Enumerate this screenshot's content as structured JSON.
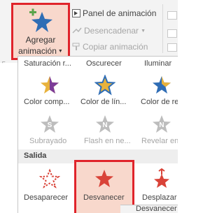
{
  "ribbon": {
    "add_animation_line1": "Agregar",
    "add_animation_line2": "animación",
    "animation_pane": "Panel de animación",
    "trigger": "Desencadenar",
    "animation_painter": "Copiar animación"
  },
  "gallery": {
    "row1": [
      "Saturación r...",
      "Oscurecer",
      "Iluminar"
    ],
    "row2": [
      "Color comp...",
      "Color de lín...",
      "Color de re"
    ],
    "row3": [
      "Subrayado",
      "Flash en ne...",
      "Revelar en"
    ],
    "section_exit": "Salida",
    "row4": [
      "Desaparecer",
      "Desvanecer",
      "Desplazar h"
    ],
    "bottom_label": "Desvanecer"
  },
  "colors": {
    "accent_red": "#e0242b",
    "selected_bg": "#f8d8cc",
    "star_blue": "#2f6db5",
    "star_gold": "#e8b23c",
    "star_purple": "#7d3c98",
    "exit_red": "#d94338"
  }
}
